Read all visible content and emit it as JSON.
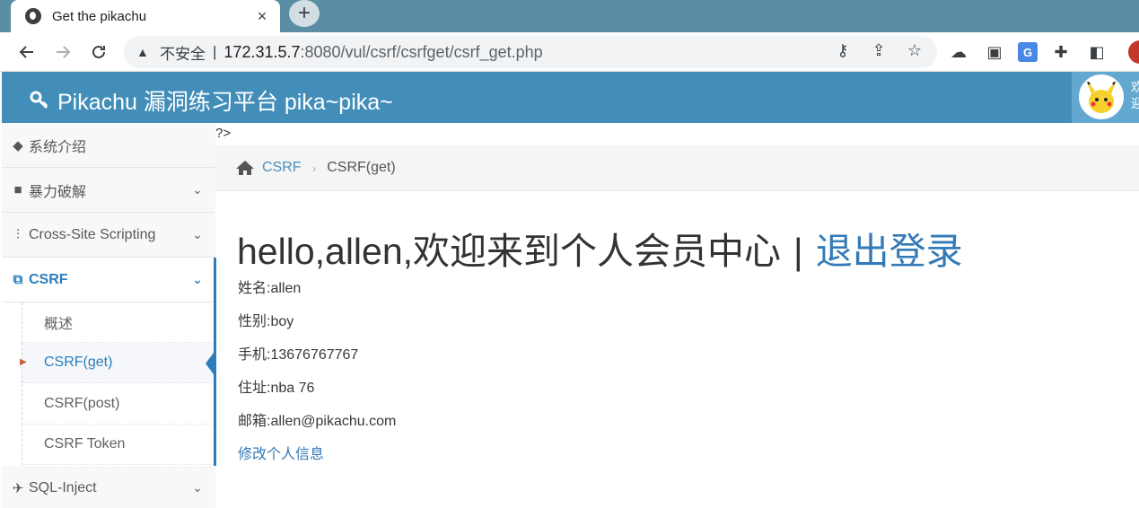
{
  "browser": {
    "tab_title": "Get the pikachu",
    "tab_close": "×",
    "new_tab": "+",
    "security_label": "不安全",
    "separator": "|",
    "url_host": "172.31.5.7",
    "url_rest": ":8080/vul/csrf/csrfget/csrf_get.php"
  },
  "header": {
    "brand": "Pikachu 漏洞练习平台 pika~pika~",
    "user_text": "欢迎"
  },
  "sidebar": {
    "items": [
      {
        "label": "系统介绍",
        "icon": "tags-icon"
      },
      {
        "label": "暴力破解",
        "icon": "lock-icon"
      },
      {
        "label": "Cross-Site Scripting",
        "icon": "list-icon"
      },
      {
        "label": "CSRF",
        "icon": "share-icon"
      },
      {
        "label": "SQL-Inject",
        "icon": "plane-icon"
      }
    ],
    "csrf_sub": [
      "概述",
      "CSRF(get)",
      "CSRF(post)",
      "CSRF Token"
    ]
  },
  "main": {
    "stray_text": "?>",
    "breadcrumb": {
      "root": "CSRF",
      "current": "CSRF(get)"
    },
    "greeting": "hello,allen,欢迎来到个人会员中心",
    "greeting_sep": "|",
    "logout": "退出登录",
    "fields": {
      "name": "姓名:allen",
      "gender": "性别:boy",
      "phone": "手机:13676767767",
      "address": "住址:nba 76",
      "email": "邮箱:allen@pikachu.com"
    },
    "edit_link": "修改个人信息"
  },
  "colors": {
    "header_bg": "#438eb9",
    "link": "#337ab7",
    "active": "#2b7dbc",
    "tabstrip": "#5b8ea4"
  }
}
